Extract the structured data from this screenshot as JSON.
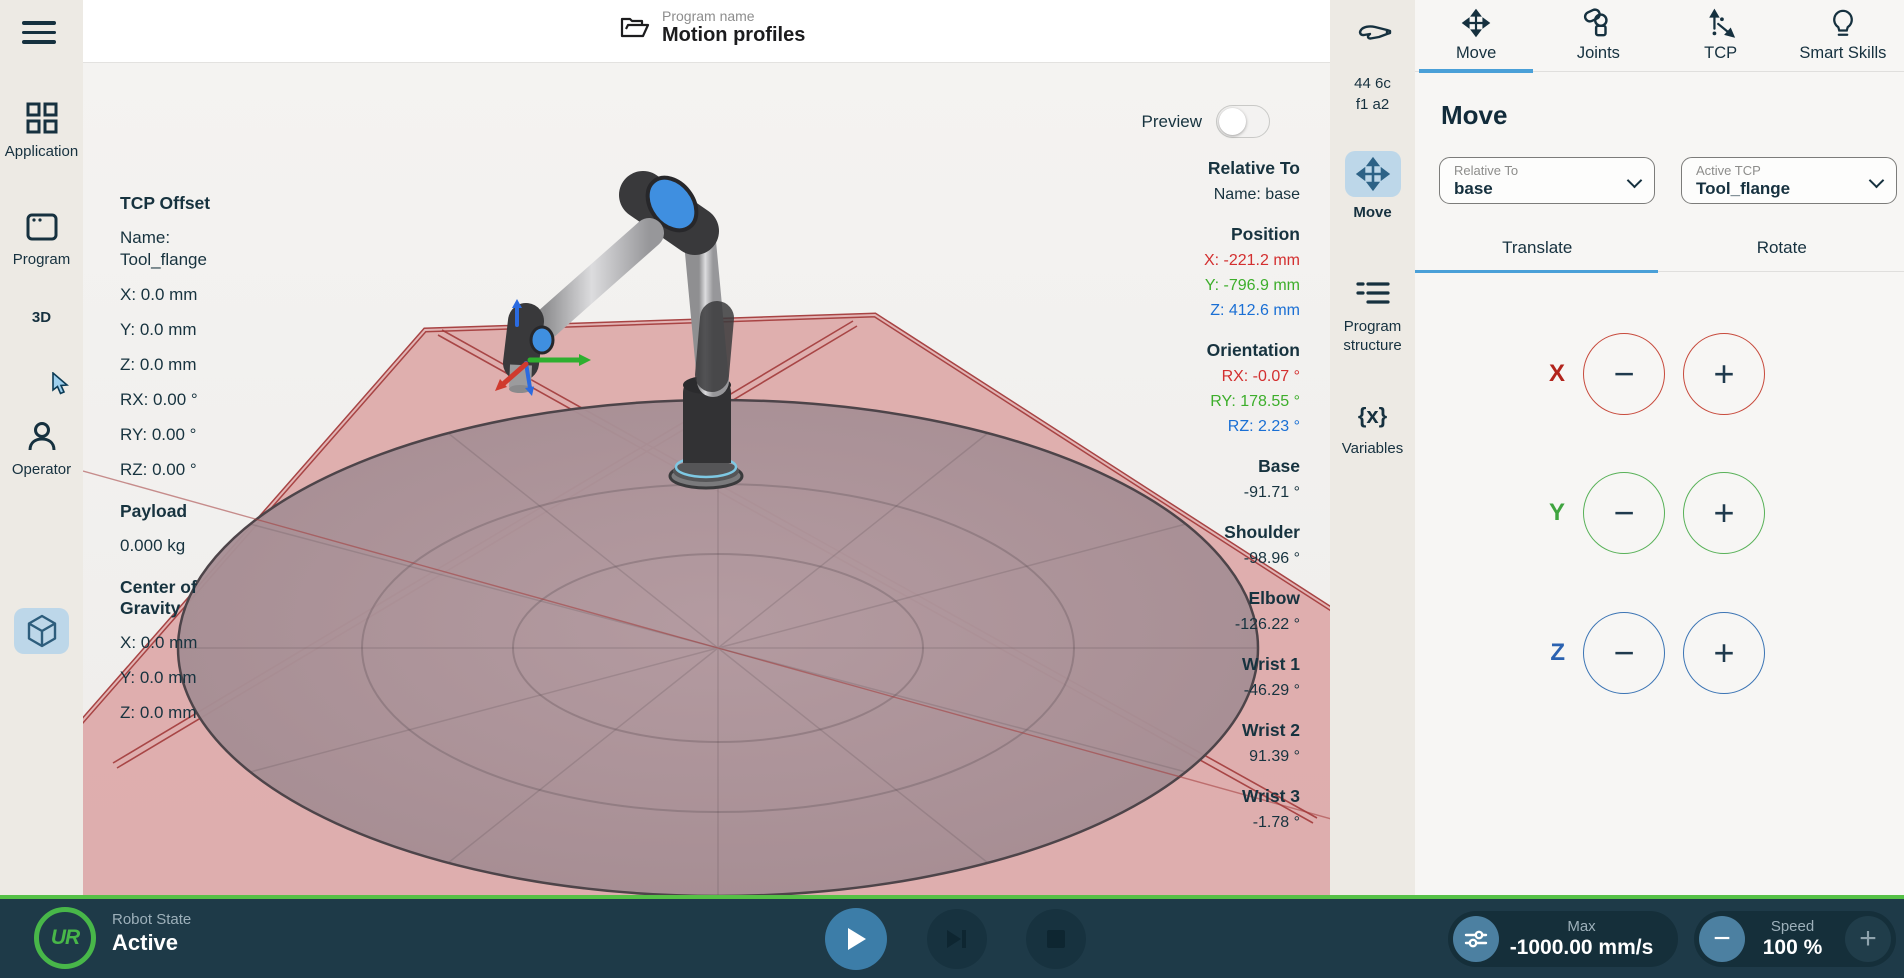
{
  "header": {
    "program_label": "Program name",
    "program_name": "Motion profiles"
  },
  "sidebar": {
    "items": [
      {
        "label": "Application"
      },
      {
        "label": "Program"
      },
      {
        "label": "3D",
        "active": true
      },
      {
        "label": "Operator"
      }
    ]
  },
  "viewport": {
    "preview_label": "Preview",
    "tcp_offset": {
      "title": "TCP Offset",
      "name": "Name: Tool_flange",
      "x": "X: 0.0 mm",
      "y": "Y: 0.0 mm",
      "z": "Z: 0.0 mm",
      "rx": "RX: 0.00 °",
      "ry": "RY: 0.00 °",
      "rz": "RZ: 0.00 °",
      "payload_title": "Payload",
      "payload_value": "0.000 kg",
      "cog_title": "Center of Gravity",
      "cog_x": "X: 0.0 mm",
      "cog_y": "Y: 0.0 mm",
      "cog_z": "Z: 0.0 mm"
    },
    "info": {
      "relative_title": "Relative To",
      "relative_name": "Name: base",
      "position_title": "Position",
      "pos_x": "X: -221.2 mm",
      "pos_y": "Y: -796.9 mm",
      "pos_z": "Z: 412.6 mm",
      "orientation_title": "Orientation",
      "ori_rx": "RX: -0.07 °",
      "ori_ry": "RY: 178.55 °",
      "ori_rz": "RZ: 2.23 °",
      "joints": [
        {
          "label": "Base",
          "value": "-91.71 °"
        },
        {
          "label": "Shoulder",
          "value": "-98.96 °"
        },
        {
          "label": "Elbow",
          "value": "-126.22 °"
        },
        {
          "label": "Wrist 1",
          "value": "-46.29 °"
        },
        {
          "label": "Wrist 2",
          "value": "91.39 °"
        },
        {
          "label": "Wrist 3",
          "value": "-1.78 °"
        }
      ]
    }
  },
  "toolbar": {
    "device_id_line1": "44 6c",
    "device_id_line2": "f1 a2",
    "move_label": "Move",
    "program_structure_label_1": "Program",
    "program_structure_label_2": "structure",
    "variables_glyph": "{x}",
    "variables_label": "Variables"
  },
  "panel": {
    "tabs": [
      {
        "label": "Move",
        "active": true
      },
      {
        "label": "Joints"
      },
      {
        "label": "TCP"
      },
      {
        "label": "Smart Skills"
      }
    ],
    "title": "Move",
    "relative_dropdown": {
      "label": "Relative To",
      "value": "base"
    },
    "tcp_dropdown": {
      "label": "Active TCP",
      "value": "Tool_flange"
    },
    "subtabs": [
      {
        "label": "Translate",
        "active": true
      },
      {
        "label": "Rotate"
      }
    ],
    "axes": [
      {
        "label": "X"
      },
      {
        "label": "Y"
      },
      {
        "label": "Z"
      }
    ],
    "minus_glyph": "−",
    "plus_glyph": "+"
  },
  "bottom": {
    "robot_state_label": "Robot State",
    "robot_state_value": "Active",
    "max_label": "Max",
    "max_value": "-1000.00 mm/s",
    "speed_label": "Speed",
    "speed_value": "100 %",
    "minus_glyph": "−",
    "plus_glyph": "+",
    "logo_text": "UR"
  },
  "colors": {
    "accent_blue": "#4aa0d8",
    "selected_tile_blue": "#bdd7e9",
    "axis_x_red": "#c0392b",
    "axis_y_green": "#3fa43f",
    "axis_z_blue": "#2b62b0",
    "position_x_red": "#d32f2f",
    "position_y_green": "#3dae2b",
    "position_z_blue": "#1a6fd4",
    "bottom_bar_navy": "#1e3a48",
    "state_green": "#48b749",
    "safety_plane_pink": "#dca5a5",
    "sidebar_beige": "#edeae4"
  }
}
